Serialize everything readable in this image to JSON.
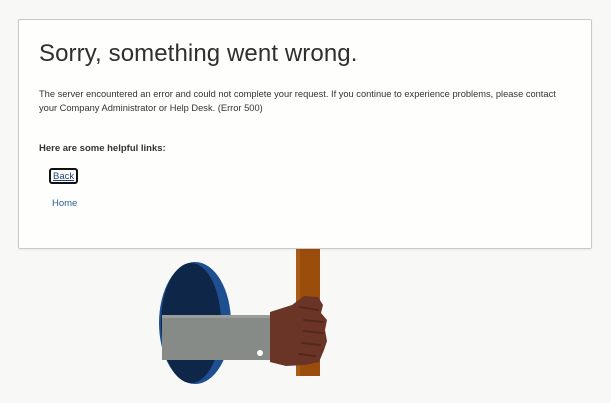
{
  "error_page": {
    "title": "Sorry, something went wrong.",
    "message": "The server encountered an error and could not complete your request. If you continue to experience problems, please contact your Company Administrator or Help Desk. (Error 500)",
    "links_heading": "Here are some helpful links:",
    "links": [
      {
        "label": "Back"
      },
      {
        "label": "Home"
      }
    ]
  },
  "colors": {
    "page_background": "#f8f8f6",
    "card_background": "#fefefc",
    "link": "#2d5c9a",
    "portal_dark": "#0e2748",
    "portal_rim": "#1d4f91",
    "sleeve": "#878b88",
    "hand": "#6a3526",
    "sign_post": "#9b4d0b"
  },
  "illustration": {
    "icon": "hand-holding-sign-illustration"
  }
}
